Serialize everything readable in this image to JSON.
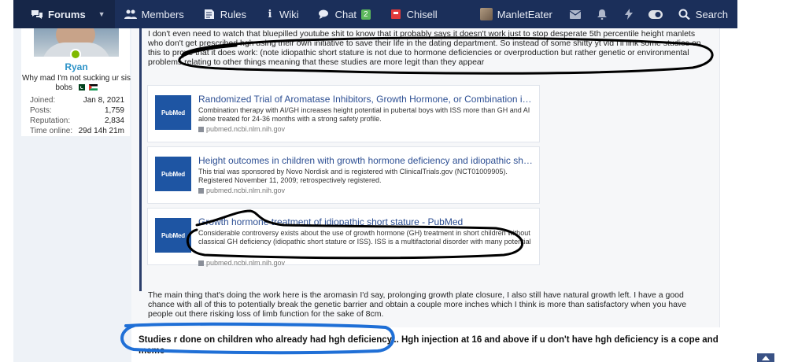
{
  "nav": {
    "forums": "Forums",
    "members": "Members",
    "rules": "Rules",
    "wiki": "Wiki",
    "chat": "Chat",
    "chat_badge": "2",
    "chisell": "Chisell",
    "username": "ManletEater",
    "search": "Search"
  },
  "user": {
    "name": "Ryan",
    "title": "Why mad I'm not sucking ur sis bobs",
    "stats": [
      {
        "label": "Joined:",
        "value": "Jan 8, 2021"
      },
      {
        "label": "Posts:",
        "value": "1,759"
      },
      {
        "label": "Reputation:",
        "value": "2,834"
      },
      {
        "label": "Time online:",
        "value": "29d 14h 21m"
      }
    ]
  },
  "post": {
    "intro": "I don't even need to watch that bluepilled youtube shit to know that it probably says it doesn't work just to stop desperate 5th percentile height manlets who don't get prescribed hgh using their own initiative to save their life in the dating department. So instead of some shitty yt vid I'll link some studies on this to prove that it does work: (note idiopathic short stature is not due to hormone deficiencies or overproduction but rather genetic or environmental problems relating to other things meaning that these studies are more legit than they appear",
    "embeds": [
      {
        "thumb": "PubMed",
        "title": "Randomized Trial of Aromatase Inhibitors, Growth Hormone, or Combination in Pu...",
        "desc": "Combination therapy with AI/GH increases height potential in pubertal boys with ISS more than GH and AI alone treated for 24-36 months with a strong safety profile.",
        "source": "pubmed.ncbi.nlm.nih.gov"
      },
      {
        "thumb": "PubMed",
        "title": "Height outcomes in children with growth hormone deficiency and idiopathic short st...",
        "desc": "This trial was sponsored by Novo Nordisk and is registered with ClinicalTrials.gov (NCT01009905). Registered November 11, 2009; retrospectively registered.",
        "source": "pubmed.ncbi.nlm.nih.gov"
      },
      {
        "thumb": "PubMed",
        "title": "Growth hormone treatment of idiopathic short stature - PubMed",
        "desc": "Considerable controversy exists about the use of growth hormone (GH) treatment in short children without classical GH deficiency (idiopathic short stature or ISS). ISS is a multifactorial disorder with many potential causes rather than a single diagnostic entity and it is a...",
        "source": "pubmed.ncbi.nlm.nih.gov"
      }
    ],
    "outro": "The main thing that's doing the work here is the aromasin I'd say, prolonging growth plate closure, I also still have natural growth left. I have a good chance with all of this to potentially break the genetic barrier and obtain a couple more inches which I think is more than satisfactory when you have people out there risking loss of limb function for the sake of 8cm."
  },
  "reply": {
    "text": "Studies r done on children who already had hgh deficiency... Hgh injection at 16 and above if u don't have hgh deficiency is a cope and meme"
  },
  "colors": {
    "nav_bg": "#1b2f5a",
    "link": "#2d4f93",
    "username": "#2d93c8",
    "pubmed": "#1e55a3",
    "annotation_black": "#000000",
    "annotation_blue": "#1f6fd6"
  }
}
